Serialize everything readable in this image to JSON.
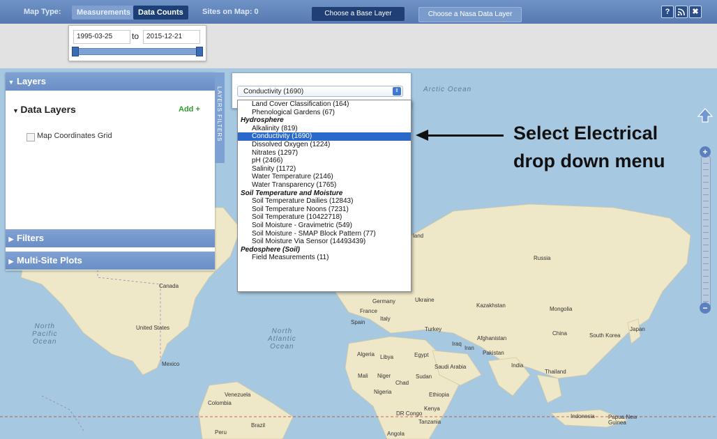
{
  "topbar": {
    "map_type_label": "Map Type:",
    "measurements_label": "Measurements",
    "data_counts_label": "Data Counts",
    "sites_label": "Sites on Map: 0",
    "base_layer_btn": "Choose a Base Layer",
    "nasa_layer_btn": "Choose a Nasa Data Layer",
    "help_icon": "?",
    "close_icon": "✖"
  },
  "dates": {
    "start": "1995-03-25",
    "to": "to",
    "end": "2015-12-21"
  },
  "panel": {
    "layers_title": "Layers",
    "data_layers_title": "Data Layers",
    "add_label": "Add +",
    "grid_label": "Map Coordinates Grid",
    "filters_title": "Filters",
    "multisite_title": "Multi-Site Plots",
    "vtab_label": "LAYERS FILTERS"
  },
  "dropdown": {
    "selected": "Conductivity (1690)",
    "items": [
      {
        "label": "Land Cover Classification (164)",
        "group": false
      },
      {
        "label": "Phenological Gardens (67)",
        "group": false
      },
      {
        "label": "Hydrosphere",
        "group": true
      },
      {
        "label": "Alkalinity (819)",
        "group": false
      },
      {
        "label": "Conductivity (1690)",
        "group": false,
        "selected": true
      },
      {
        "label": "Dissolved Oxygen (1224)",
        "group": false
      },
      {
        "label": "Nitrates (1297)",
        "group": false
      },
      {
        "label": "pH (2466)",
        "group": false
      },
      {
        "label": "Salinity (1172)",
        "group": false
      },
      {
        "label": "Water Temperature (2146)",
        "group": false
      },
      {
        "label": "Water Transparency (1765)",
        "group": false
      },
      {
        "label": "Soil Temperature and Moisture",
        "group": true
      },
      {
        "label": "Soil Temperature Dailies (12843)",
        "group": false
      },
      {
        "label": "Soil Temperature Noons (7231)",
        "group": false
      },
      {
        "label": "Soil Temperature (10422718)",
        "group": false
      },
      {
        "label": "Soil Moisture - Gravimetric (549)",
        "group": false
      },
      {
        "label": "Soil Moisture - SMAP Block Pattern (77)",
        "group": false
      },
      {
        "label": "Soil Moisture Via Sensor (14493439)",
        "group": false
      },
      {
        "label": "Pedosphere (Soil)",
        "group": true
      },
      {
        "label": "Field Measurements (11)",
        "group": false
      }
    ]
  },
  "annotation": {
    "line1": "Select Electrical",
    "line2": "drop down menu"
  },
  "map": {
    "arctic": "Arctic Ocean",
    "north_pacific": "North\nPacific\nOcean",
    "north_atlantic": "North\nAtlantic\nOcean",
    "countries": {
      "canada": "Canada",
      "united_states": "United States",
      "mexico": "Mexico",
      "venezuela": "Venezuela",
      "colombia": "Colombia",
      "peru": "Peru",
      "brazil": "Brazil",
      "russia": "Russia",
      "kazakhstan": "Kazakhstan",
      "mongolia": "Mongolia",
      "china": "China",
      "japan": "Japan",
      "south_korea": "South Korea",
      "afghanistan": "Afghanistan",
      "pakistan": "Pakistan",
      "india": "India",
      "iraq": "Iraq",
      "iran": "Iran",
      "turkey": "Turkey",
      "germany": "Germany",
      "ukraine": "Ukraine",
      "france": "France",
      "spain": "Spain",
      "italy": "Italy",
      "algeria": "Algeria",
      "libya": "Libya",
      "egypt": "Egypt",
      "saudi_arabia": "Saudi Arabia",
      "mali": "Mali",
      "niger": "Niger",
      "chad": "Chad",
      "sudan": "Sudan",
      "nigeria": "Nigeria",
      "ethiopia": "Ethiopia",
      "kenya": "Kenya",
      "dr_congo": "DR Congo",
      "tanzania": "Tanzania",
      "angola": "Angola",
      "thailand": "Thailand",
      "indonesia": "Indonesia",
      "papua": "Papua New\nGuinea",
      "finland": "Finland",
      "poland": "Poland",
      "land": "land"
    }
  },
  "colors": {
    "topbar": "#5f83ba",
    "selected_item": "#2a68c9",
    "land": "#efe8c8",
    "ocean": "#a6c8e0"
  }
}
